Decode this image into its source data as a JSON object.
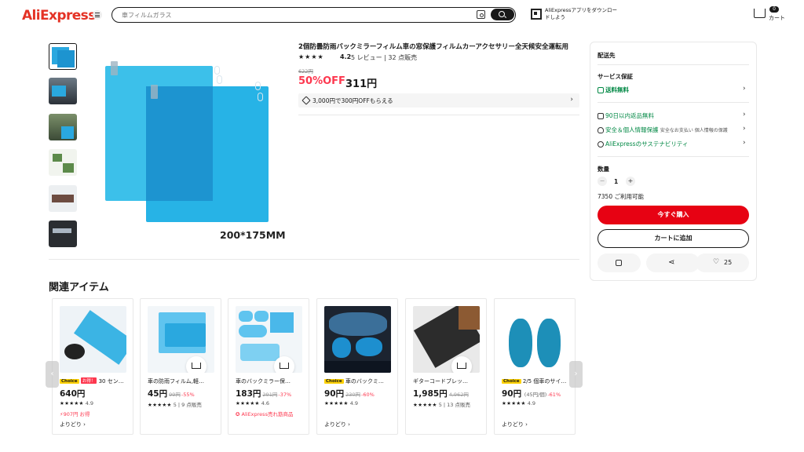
{
  "header": {
    "logo": "AliExpress",
    "search_placeholder": "車フィルムガラス",
    "app_promo": "AliExpressアプリをダウンロードしよう",
    "cart_count": "0",
    "cart_label": "カート"
  },
  "product": {
    "title": "2個防曇防雨バックミラーフィルム車の窓保護フィルムカーアクセサリー全天候安全運転用",
    "stars": "★★★★",
    "rating": "4.2",
    "reviews": "5 レビュー | 32 点販売",
    "original_price": "622円",
    "discount": "50%OFF",
    "price": "311円",
    "coupon": "3,000円で300円OFFもらえる",
    "image_caption": "200*175MM"
  },
  "side": {
    "ship_to": "配送先",
    "service_title": "サービス保証",
    "free_shipping": "送料無料",
    "return": "90日以内返品無料",
    "security": "安全＆個人情報保護",
    "security_desc": "安全なお支払い 個人情報の保護",
    "sustainability": "AliExpressのサステナビリティ",
    "qty_label": "数量",
    "qty_value": "1",
    "minus": "−",
    "plus": "+",
    "available": "7350 ご利用可能",
    "buy_now": "今すぐ購入",
    "add_to_cart": "カートに追加",
    "wish_count": "25"
  },
  "related": {
    "title": "関連アイテム",
    "more_label": "よりどり",
    "items": [
      {
        "choice": "Choice",
        "deal": "お得！",
        "title": "30 セン…",
        "price": "640円",
        "old": "",
        "off": "",
        "stars": "★★★★★",
        "rating": "4.9",
        "extra": "907円 お得"
      },
      {
        "choice": "",
        "deal": "",
        "title": "車の防雨フィルム,軽…",
        "price": "45円",
        "old": "99円",
        "off": "-55%",
        "stars": "★★★★★",
        "rating": "5 | 9 点販売",
        "extra": ""
      },
      {
        "choice": "",
        "deal": "",
        "title": "車のバックミラー保…",
        "price": "183円",
        "old": "291円",
        "off": "-37%",
        "stars": "★★★★★",
        "rating": "4.6",
        "extra": "AliExpress売れ筋商品"
      },
      {
        "choice": "Choice",
        "deal": "",
        "title": "車のバックミ…",
        "price": "90円",
        "old": "230円",
        "off": "-60%",
        "stars": "★★★★★",
        "rating": "4.9",
        "extra": ""
      },
      {
        "choice": "",
        "deal": "",
        "title": "ギターコードブレッ…",
        "price": "1,985円",
        "old": "4,962円",
        "off": "",
        "stars": "★★★★★",
        "rating": "5 | 13 点販売",
        "extra": ""
      },
      {
        "choice": "Choice",
        "deal": "",
        "title": "2/5 個車のサイ…",
        "price": "90円",
        "sub": "(45円/個)",
        "old": "",
        "off": "-61%",
        "stars": "★★★★★",
        "rating": "4.9",
        "extra": ""
      }
    ]
  },
  "colors": {
    "accent": "#e70213",
    "discount": "#fd384f",
    "green": "#018844",
    "film": "#27b3e6"
  }
}
